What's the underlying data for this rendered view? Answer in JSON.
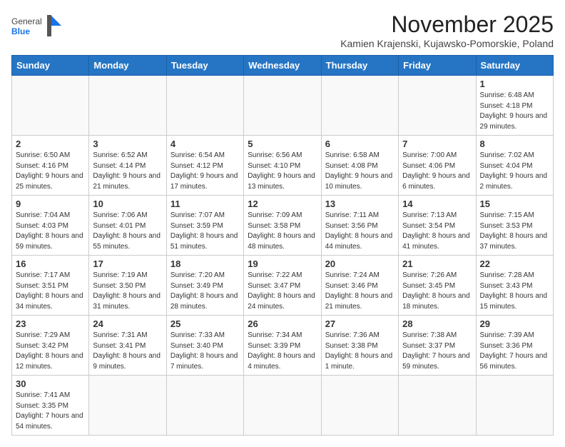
{
  "header": {
    "logo_general": "General",
    "logo_blue": "Blue",
    "month_title": "November 2025",
    "location": "Kamien Krajenski, Kujawsko-Pomorskie, Poland"
  },
  "days_of_week": [
    "Sunday",
    "Monday",
    "Tuesday",
    "Wednesday",
    "Thursday",
    "Friday",
    "Saturday"
  ],
  "weeks": [
    [
      {
        "day": "",
        "info": ""
      },
      {
        "day": "",
        "info": ""
      },
      {
        "day": "",
        "info": ""
      },
      {
        "day": "",
        "info": ""
      },
      {
        "day": "",
        "info": ""
      },
      {
        "day": "",
        "info": ""
      },
      {
        "day": "1",
        "info": "Sunrise: 6:48 AM\nSunset: 4:18 PM\nDaylight: 9 hours and 29 minutes."
      }
    ],
    [
      {
        "day": "2",
        "info": "Sunrise: 6:50 AM\nSunset: 4:16 PM\nDaylight: 9 hours and 25 minutes."
      },
      {
        "day": "3",
        "info": "Sunrise: 6:52 AM\nSunset: 4:14 PM\nDaylight: 9 hours and 21 minutes."
      },
      {
        "day": "4",
        "info": "Sunrise: 6:54 AM\nSunset: 4:12 PM\nDaylight: 9 hours and 17 minutes."
      },
      {
        "day": "5",
        "info": "Sunrise: 6:56 AM\nSunset: 4:10 PM\nDaylight: 9 hours and 13 minutes."
      },
      {
        "day": "6",
        "info": "Sunrise: 6:58 AM\nSunset: 4:08 PM\nDaylight: 9 hours and 10 minutes."
      },
      {
        "day": "7",
        "info": "Sunrise: 7:00 AM\nSunset: 4:06 PM\nDaylight: 9 hours and 6 minutes."
      },
      {
        "day": "8",
        "info": "Sunrise: 7:02 AM\nSunset: 4:04 PM\nDaylight: 9 hours and 2 minutes."
      }
    ],
    [
      {
        "day": "9",
        "info": "Sunrise: 7:04 AM\nSunset: 4:03 PM\nDaylight: 8 hours and 59 minutes."
      },
      {
        "day": "10",
        "info": "Sunrise: 7:06 AM\nSunset: 4:01 PM\nDaylight: 8 hours and 55 minutes."
      },
      {
        "day": "11",
        "info": "Sunrise: 7:07 AM\nSunset: 3:59 PM\nDaylight: 8 hours and 51 minutes."
      },
      {
        "day": "12",
        "info": "Sunrise: 7:09 AM\nSunset: 3:58 PM\nDaylight: 8 hours and 48 minutes."
      },
      {
        "day": "13",
        "info": "Sunrise: 7:11 AM\nSunset: 3:56 PM\nDaylight: 8 hours and 44 minutes."
      },
      {
        "day": "14",
        "info": "Sunrise: 7:13 AM\nSunset: 3:54 PM\nDaylight: 8 hours and 41 minutes."
      },
      {
        "day": "15",
        "info": "Sunrise: 7:15 AM\nSunset: 3:53 PM\nDaylight: 8 hours and 37 minutes."
      }
    ],
    [
      {
        "day": "16",
        "info": "Sunrise: 7:17 AM\nSunset: 3:51 PM\nDaylight: 8 hours and 34 minutes."
      },
      {
        "day": "17",
        "info": "Sunrise: 7:19 AM\nSunset: 3:50 PM\nDaylight: 8 hours and 31 minutes."
      },
      {
        "day": "18",
        "info": "Sunrise: 7:20 AM\nSunset: 3:49 PM\nDaylight: 8 hours and 28 minutes."
      },
      {
        "day": "19",
        "info": "Sunrise: 7:22 AM\nSunset: 3:47 PM\nDaylight: 8 hours and 24 minutes."
      },
      {
        "day": "20",
        "info": "Sunrise: 7:24 AM\nSunset: 3:46 PM\nDaylight: 8 hours and 21 minutes."
      },
      {
        "day": "21",
        "info": "Sunrise: 7:26 AM\nSunset: 3:45 PM\nDaylight: 8 hours and 18 minutes."
      },
      {
        "day": "22",
        "info": "Sunrise: 7:28 AM\nSunset: 3:43 PM\nDaylight: 8 hours and 15 minutes."
      }
    ],
    [
      {
        "day": "23",
        "info": "Sunrise: 7:29 AM\nSunset: 3:42 PM\nDaylight: 8 hours and 12 minutes."
      },
      {
        "day": "24",
        "info": "Sunrise: 7:31 AM\nSunset: 3:41 PM\nDaylight: 8 hours and 9 minutes."
      },
      {
        "day": "25",
        "info": "Sunrise: 7:33 AM\nSunset: 3:40 PM\nDaylight: 8 hours and 7 minutes."
      },
      {
        "day": "26",
        "info": "Sunrise: 7:34 AM\nSunset: 3:39 PM\nDaylight: 8 hours and 4 minutes."
      },
      {
        "day": "27",
        "info": "Sunrise: 7:36 AM\nSunset: 3:38 PM\nDaylight: 8 hours and 1 minute."
      },
      {
        "day": "28",
        "info": "Sunrise: 7:38 AM\nSunset: 3:37 PM\nDaylight: 7 hours and 59 minutes."
      },
      {
        "day": "29",
        "info": "Sunrise: 7:39 AM\nSunset: 3:36 PM\nDaylight: 7 hours and 56 minutes."
      }
    ],
    [
      {
        "day": "30",
        "info": "Sunrise: 7:41 AM\nSunset: 3:35 PM\nDaylight: 7 hours and 54 minutes."
      },
      {
        "day": "",
        "info": ""
      },
      {
        "day": "",
        "info": ""
      },
      {
        "day": "",
        "info": ""
      },
      {
        "day": "",
        "info": ""
      },
      {
        "day": "",
        "info": ""
      },
      {
        "day": "",
        "info": ""
      }
    ]
  ]
}
